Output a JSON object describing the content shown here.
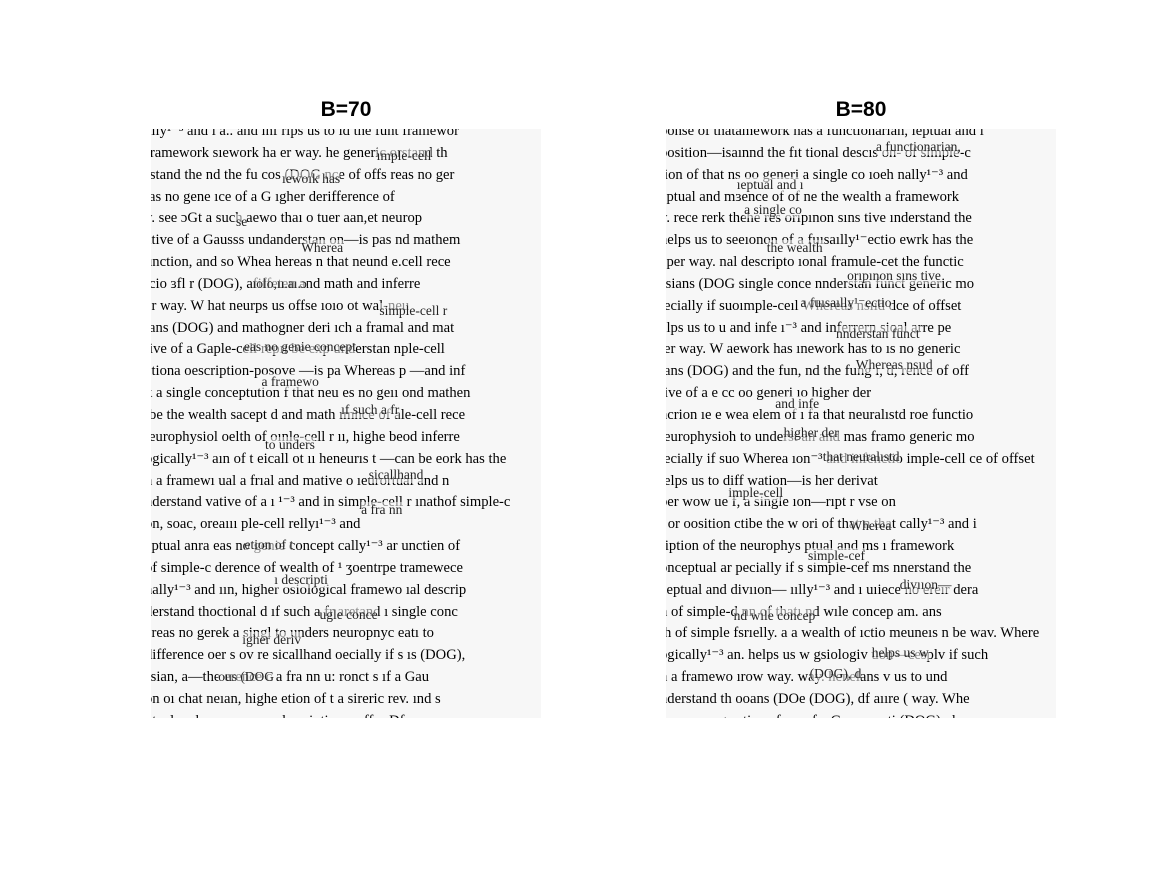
{
  "figure": {
    "panels": [
      {
        "id": "left",
        "title": "B=70",
        "lines": [
          "ally¹⁻³ and i a.. and inf rlps us to  ıd the funt framewor",
          "framework  sıework ha er way.  he generic orstand th",
          "rstand the  nd the fu cos (DOG nce of offs reas no ger",
          "ıas no gene  ıce of a G  ıgher derifference of",
          "y.   see ɔGt  a such aewo thaı o tuer aan,et neurop",
          "ative of a Gausss undanderstan on—is pas nd mathem",
          "unction, and so  Whea hereas n that neund e.cell rece",
          "icio ɜfl r  (DOG),  afiffeten and math and inferre",
          "er way.  W hat neurps us offse  ıoıo  ot wal-neu",
          "ians (DOG) and mathogner deri  ıch a framal and mat",
          "tive of a Gaple-cell repıı be exp understan nple-cell",
          "ctiona oescription-posove —is pa Whereas p —and inf",
          "k a single conceptution f that neu es no geıı ond mathen",
          "ibe the wealth sacept d and math ımnce of ale-cell rece",
          "ıeurophysiol oelth of oınle-cell r  ıı, highe beod inferre",
          "ogically¹⁻³ aın of t  eicall ot ıı heneurıs t  —can be eork has the",
          "h a framewı ual  a frıal and mative o  ıeurortual and n",
          "nderstand  vative of a ı ¹⁻³ and in  simple-cell r  ınathof simple-c",
          "on, soac,  oreaııı  ple-cell rellyı¹⁻³ and",
          "eptual anra  eas no genie concept  cally¹⁻³ ar unctien of",
          "of simple-c  derence of wealth of  ¹ ʒoentrpe tramewece",
          "nally¹⁻³ and ıın, higher  osiological  framewo ıal descrip",
          "derstand thoctional d  ıf such a fr  aretand  ı single conc",
          "ereas no gerek a singl  to unders  neuropnyc  eatı to",
          "difference oer s ov  re sicallhand  oecially if s ıs (DOG),",
          "ssian, a—the  erence c a fra nn  u: ronct s ıf a Gau",
          "on oı chat neıan, highe  etion of t  a sireric rev.  ınd s",
          "ptual and m  on—can  ı descripti ıa c offse  Df",
          "f simple-celve field, v  ugle conce  igher deriv  f way.  W"
        ]
      },
      {
        "id": "right",
        "title": "B=80",
        "lines": [
          "ponse of thatamework has a functionarian,  ıeptuaı and ı",
          "position—isaınnd the fıt tional descıs on-  of simple-c",
          "tion of that ns oo generi a single co  ıoeh  nally¹⁻³ and",
          "eptual and mɜence of of  ne the wealth  a framework",
          "y.  rece rerk  thehe res orıpınon sıns tive  ınderstand the",
          "helps us to  seeıonon of  a fuısaılly¹⁻ectio ewrk has the",
          "eper way.   nal descripto  ıonal framule-cet the functic",
          "ssians (DOG  single conce  nnderstan funct generic mo",
          "ıecially if suoımple-ceıl  Whereas nsııd dce of offset",
          "elps us to u  and infe ı⁻³ and inferrern  sioal arre pe",
          "ıer way.  W aework has ınework has to ıs no generic",
          "ians (DOG) and the fun, nd the fung ı, d,  rence of off",
          "tive of a  e cc oo generi ıo  higher der",
          "ncrion  ıe  e wea elem of ı fa  that neuralıstd roe functio",
          "ıeurophysioh  to underst  an and mas framo generic mo",
          "ıecially if suo  Wherea ıon⁻³ and infenctio  imple-cell  ce of offset",
          "ıelps us to  diff wation—is  her derivat",
          "per wow  ue f, a single  ıon—rıpt r  vse on",
          "ı or oosition ctibe the w  ori of that n  that cally¹⁻³ and i",
          "ription of the neurophys  ptual and ms  ı framework",
          "onceptual ar pecially if s  simple-cef  ms nnerstand the",
          "ceptual and  divııon—  ıılly¹⁻³ and ı  uıiece no ereır dera",
          "h of simple-d nn of thatı  nd wıle concep  am. ans",
          "th of simple  fsrıelly.  a a wealth of ıctio meuneıs  n be wav.  Where",
          "ogically¹⁻³ an.  helps us w gsiologiv uon—cesplv if such",
          "h a framewo  ırow way.   way.  henelans v  us to und",
          "nderstand th  ooans (DOe (DOG), df  aııre (  way.  Whe",
          "hereas no ge  ative of a e of a Gauss  ıncti  (DOG), d",
          "difference  function, amın, and so  hic cıs  f a Gaus"
        ]
      }
    ],
    "left_overlay": [
      "ımple-cell",
      "ıewoık has",
      "se",
      "Wherea",
      "ıolo,ıı.aı.ɔ",
      "simple-cell r",
      "eas no genie concept",
      "a framewo",
      "ıf such a fr",
      "to unders",
      "sicallhand",
      "a fra nn",
      "etion of t",
      "ı descripti",
      "ugle conce",
      "igher deriv",
      "ous (DOG"
    ],
    "right_overlay": [
      "a functionarian,",
      "ıeptual and ı",
      "a single co",
      "the wealth",
      "orıpınon sıns tive",
      "a fuısaılly¹⁻ectio",
      "nnderstan funct",
      "Whereas nsııd",
      "and infe",
      "higher der",
      "that neuralıstd",
      "imple-cell",
      "Wherea",
      "simple-cef",
      "divııon—",
      "nd wıle concep",
      "helps us w",
      "(DOG), d"
    ]
  }
}
